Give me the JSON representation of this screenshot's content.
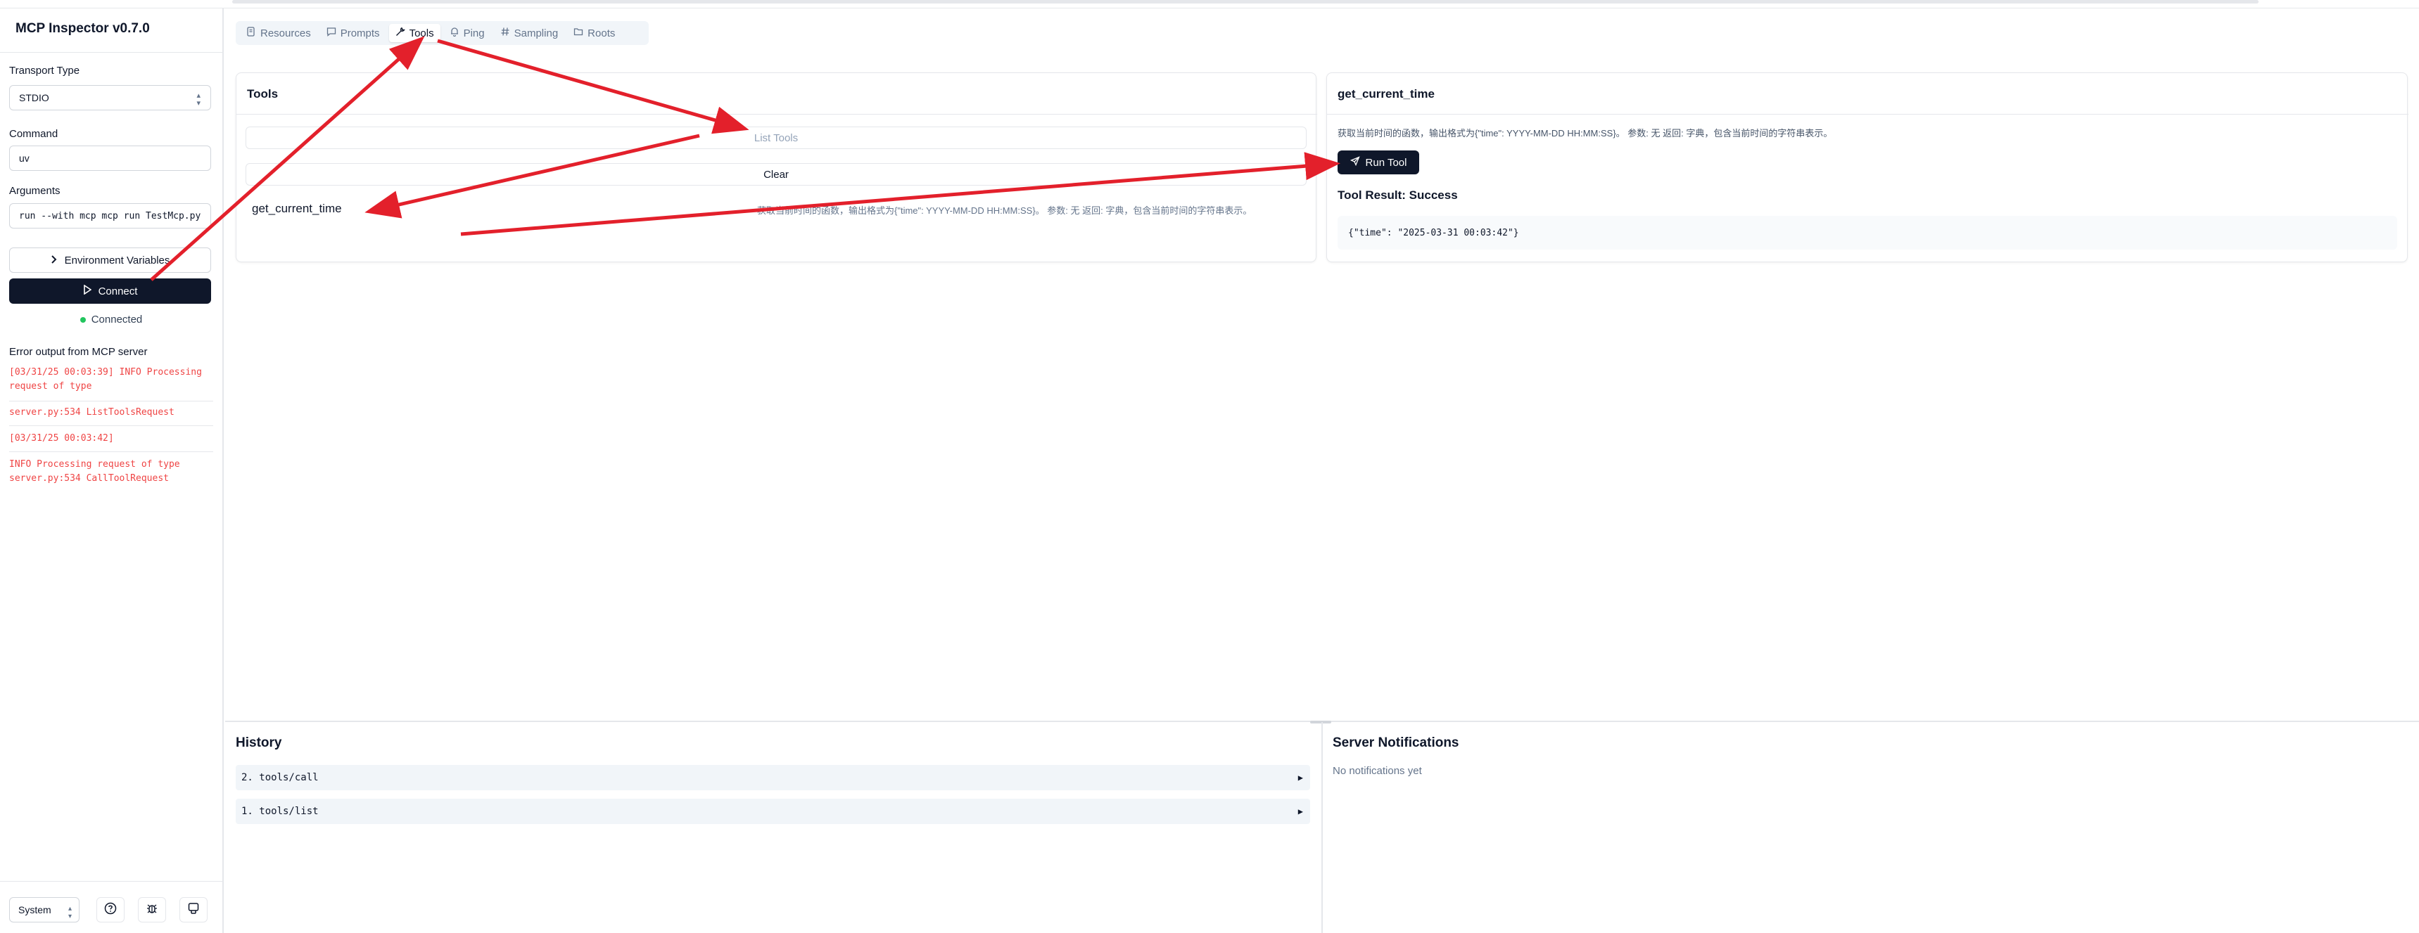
{
  "app": {
    "title": "MCP Inspector v0.7.0"
  },
  "sidebar": {
    "transport_label": "Transport Type",
    "transport_value": "STDIO",
    "command_label": "Command",
    "command_value": "uv",
    "arguments_label": "Arguments",
    "arguments_value": "run --with mcp mcp run TestMcp.py",
    "env_button": "Environment Variables",
    "connect_button": "Connect",
    "status": "Connected",
    "error_title": "Error output from MCP server",
    "error_lines": [
      "[03/31/25 00:03:39] INFO Processing request of type",
      "server.py:534 ListToolsRequest",
      "[03/31/25 00:03:42]",
      "INFO Processing request of type server.py:534 CallToolRequest"
    ],
    "theme_value": "System"
  },
  "tabs": [
    "Resources",
    "Prompts",
    "Tools",
    "Ping",
    "Sampling",
    "Roots"
  ],
  "active_tab": "Tools",
  "tools_panel": {
    "title": "Tools",
    "list_button": "List Tools",
    "clear_button": "Clear",
    "tool_name": "get_current_time",
    "tool_description": "获取当前时间的函数，输出格式为{\"time\": YYYY-MM-DD HH:MM:SS}。 参数: 无 返回: 字典，包含当前时间的字符串表示。"
  },
  "detail_panel": {
    "title": "get_current_time",
    "description": "获取当前时间的函数，输出格式为{\"time\": YYYY-MM-DD HH:MM:SS}。 参数: 无 返回: 字典，包含当前时间的字符串表示。",
    "run_button": "Run Tool",
    "result_title": "Tool Result: Success",
    "result_json": "{\"time\": \"2025-03-31 00:03:42\"}"
  },
  "history": {
    "title": "History",
    "items": [
      "2. tools/call",
      "1. tools/list"
    ]
  },
  "notifications": {
    "title": "Server Notifications",
    "empty": "No notifications yet"
  },
  "colors": {
    "primary": "#0f172a",
    "error": "#ef4444",
    "annotation_arrow": "#e3202b",
    "connected_dot": "#22c55e"
  },
  "icons": [
    "resources-icon",
    "prompts-icon",
    "tools-icon",
    "ping-icon",
    "sampling-icon",
    "roots-icon",
    "play-icon",
    "send-icon",
    "help-icon",
    "bug-icon",
    "github-icon"
  ]
}
